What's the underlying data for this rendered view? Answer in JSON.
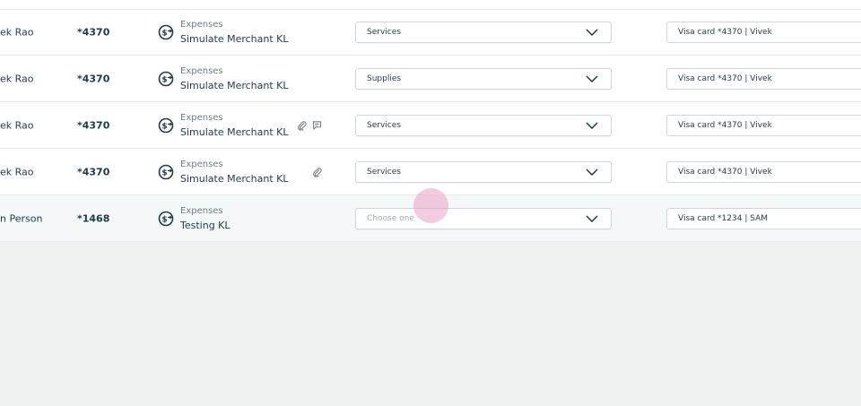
{
  "rows": [
    {
      "name": "ek Rao",
      "last4": "*4370",
      "category_icon": "expense-exchange-icon",
      "type": "Expenses",
      "merchant": "Simulate Merchant KL",
      "attachment": false,
      "comment": false,
      "category": "Services",
      "card": "Visa card *4370 | Vivek"
    },
    {
      "name": "ek Rao",
      "last4": "*4370",
      "category_icon": "expense-exchange-icon",
      "type": "Expenses",
      "merchant": "Simulate Merchant KL",
      "attachment": false,
      "comment": false,
      "category": "Supplies",
      "card": "Visa card *4370 | Vivek"
    },
    {
      "name": "ek Rao",
      "last4": "*4370",
      "category_icon": "expense-exchange-icon",
      "type": "Expenses",
      "merchant": "Simulate Merchant KL",
      "attachment": true,
      "comment": true,
      "category": "Services",
      "card": "Visa card *4370 | Vivek"
    },
    {
      "name": "ek Rao",
      "last4": "*4370",
      "category_icon": "expense-exchange-icon",
      "type": "Expenses",
      "merchant": "Simulate Merchant KL",
      "attachment": true,
      "comment": false,
      "category": "Services",
      "card": "Visa card *4370 | Vivek"
    },
    {
      "name": "n Person",
      "last4": "*1468",
      "category_icon": "expense-exchange-icon",
      "type": "Expenses",
      "merchant": "Testing KL",
      "attachment": false,
      "comment": false,
      "category": "",
      "category_placeholder": "Choose one",
      "card": "Visa card *1234 | SAM"
    }
  ],
  "icons": {
    "attachment": "paperclip-icon",
    "comment": "comment-icon",
    "dropdown": "chevron-down-icon"
  },
  "colors": {
    "text": "#1f3a4a",
    "muted": "#6b7d86",
    "placeholder": "#a0aab0",
    "background": "#eef2f0",
    "border": "#cdd6da"
  }
}
